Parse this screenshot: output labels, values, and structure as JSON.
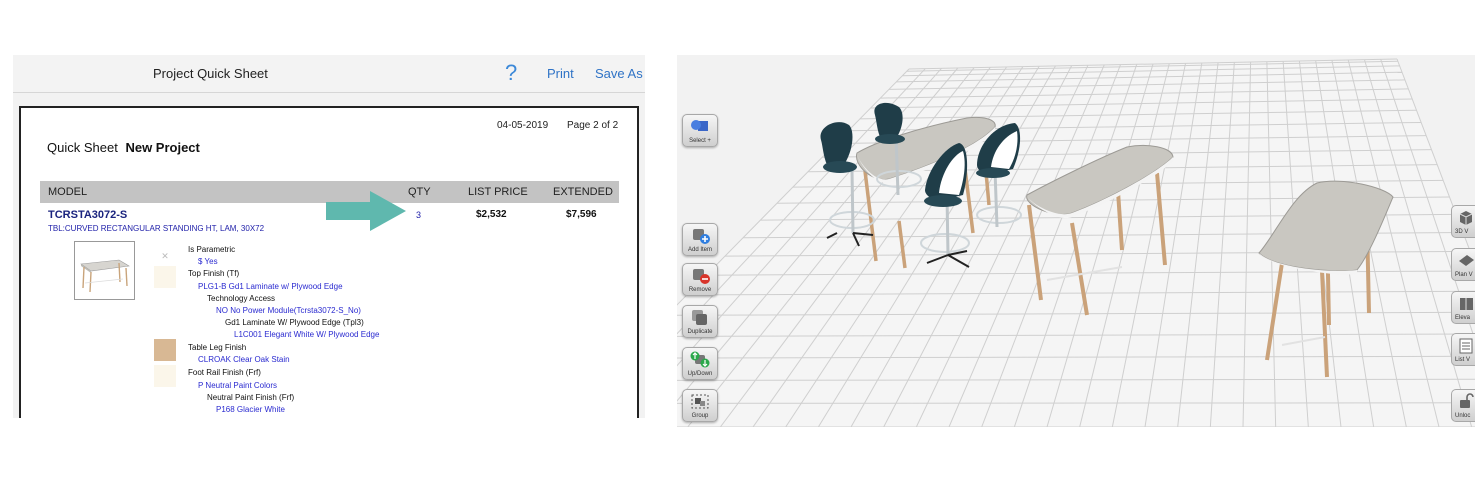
{
  "quick_sheet": {
    "header_title": "Project Quick Sheet",
    "help_label": "?",
    "print_label": "Print",
    "save_as_label": "Save As",
    "date": "04-05-2019",
    "page": "Page 2 of 2",
    "sheet_label": "Quick Sheet",
    "project_name": "New Project",
    "columns": [
      "MODEL",
      "QTY",
      "LIST PRICE",
      "EXTENDED"
    ],
    "item": {
      "model": "TCRSTA3072-S",
      "description": "TBL:CURVED RECTANGULAR STANDING HT, LAM, 30X72",
      "qty": "3",
      "list_price": "$2,532",
      "extended": "$7,596"
    },
    "options": [
      {
        "kind": "k",
        "text": "Is Parametric"
      },
      {
        "kind": "v",
        "text": "$   Yes"
      },
      {
        "kind": "k",
        "text": "Top Finish (Tf)"
      },
      {
        "kind": "v",
        "text": "PLG1-B   Gd1 Laminate w/ Plywood Edge"
      },
      {
        "kind": "k",
        "text": "Technology Access"
      },
      {
        "kind": "v",
        "text": "NO   No Power Module(Tcrsta3072-S_No)"
      },
      {
        "kind": "k",
        "text": "Gd1 Laminate W/ Plywood Edge (Tpl3)"
      },
      {
        "kind": "v",
        "text": "L1C001   Elegant White W/ Plywood Edge"
      },
      {
        "kind": "k",
        "text": "Table Leg Finish"
      },
      {
        "kind": "v",
        "text": "CLROAK   Clear Oak Stain"
      },
      {
        "kind": "k",
        "text": "Foot Rail Finish (Frf)"
      },
      {
        "kind": "v",
        "text": "P   Neutral Paint Colors"
      },
      {
        "kind": "k",
        "text": "Neutral Paint Finish (Frf)"
      },
      {
        "kind": "v",
        "text": "P168   Glacier White"
      }
    ],
    "arrow_color": "#5fb8ae"
  },
  "view3d": {
    "left_tools": [
      {
        "label": "Select +",
        "icon": "select-shapes-icon"
      },
      {
        "label": "Add Item",
        "icon": "add-item-icon"
      },
      {
        "label": "Remove",
        "icon": "remove-item-icon"
      },
      {
        "label": "Duplicate",
        "icon": "duplicate-icon"
      },
      {
        "label": "Up/Down",
        "icon": "up-down-icon"
      },
      {
        "label": "Group",
        "icon": "group-icon"
      }
    ],
    "right_tools": [
      {
        "label": "3D V",
        "icon": "3d-view-icon"
      },
      {
        "label": "Plan V",
        "icon": "plan-view-icon"
      },
      {
        "label": "Eleva",
        "icon": "elevation-view-icon"
      },
      {
        "label": "List V",
        "icon": "list-view-icon"
      },
      {
        "label": "Unloc",
        "icon": "unlock-icon"
      }
    ],
    "colors": {
      "grid_bg": "#f5f5f5",
      "grid_line": "#cfcfcf",
      "chair": "#1f3d48",
      "table_top": "#c9c7c1",
      "leg": "#c9a47b"
    }
  }
}
